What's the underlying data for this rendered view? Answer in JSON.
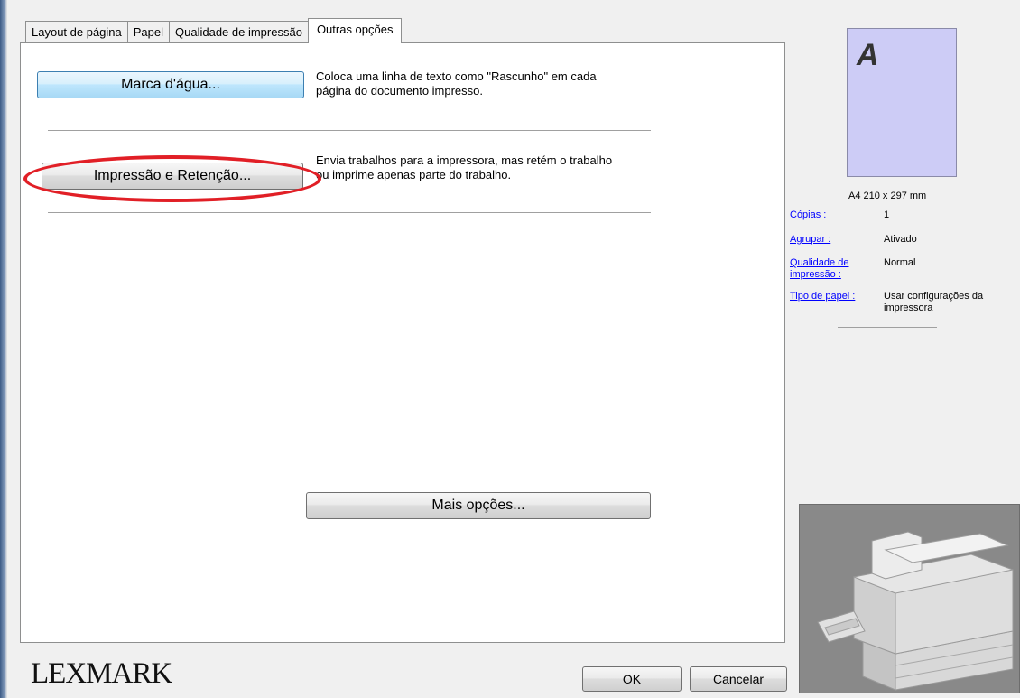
{
  "tabs": [
    {
      "label": "Layout de página"
    },
    {
      "label": "Papel"
    },
    {
      "label": "Qualidade de impressão"
    },
    {
      "label": "Outras opções",
      "active": true
    }
  ],
  "panel": {
    "watermark_button": "Marca d'água...",
    "watermark_desc_1": "Coloca uma linha de texto como \"Rascunho\" em cada",
    "watermark_desc_2": "página do documento impresso.",
    "hold_button": "Impressão e Retenção...",
    "hold_desc_1": "Envia trabalhos para a impressora, mas retém o trabalho",
    "hold_desc_2": "ou imprime apenas parte do trabalho.",
    "more_options_button": "Mais opções..."
  },
  "preview": {
    "page_letter": "A",
    "paper_size": "A4 210 x 297 mm"
  },
  "info": {
    "copies_label": "Cópias :",
    "copies_value": "1",
    "collate_label": "Agrupar :",
    "collate_value": "Ativado",
    "quality_label_1": "Qualidade de",
    "quality_label_2": "impressão :",
    "quality_value": "Normal",
    "paper_type_label": "Tipo de papel :",
    "paper_type_value_1": "Usar configurações da",
    "paper_type_value_2": "impressora"
  },
  "footer": {
    "brand": "LEXMARK",
    "ok_label": "OK",
    "cancel_label": "Cancelar"
  },
  "colors": {
    "highlight": "#e11f26",
    "link": "#0000ff",
    "preview_page": "#cdccf6",
    "printer_bg": "#898989"
  }
}
